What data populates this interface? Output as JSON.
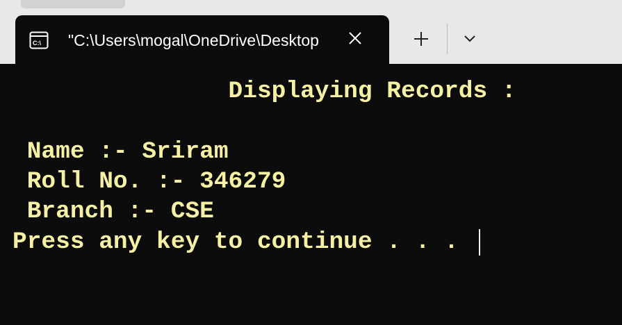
{
  "tab": {
    "title": "\"C:\\Users\\mogal\\OneDrive\\Desktop",
    "icon": "terminal-icon"
  },
  "tabbar": {
    "close_icon": "close-icon",
    "new_tab_icon": "plus-icon",
    "dropdown_icon": "chevron-down-icon"
  },
  "console": {
    "heading": "               Displaying Records :",
    "blank": "",
    "name_line": " Name :- Sriram",
    "roll_line": " Roll No. :- 346279",
    "branch_line": " Branch :- CSE",
    "prompt_line": "Press any key to continue . . ."
  },
  "colors": {
    "console_bg": "#0c0c0c",
    "console_text": "#f6f0a4",
    "titlebar_bg": "#e8e8e8"
  }
}
